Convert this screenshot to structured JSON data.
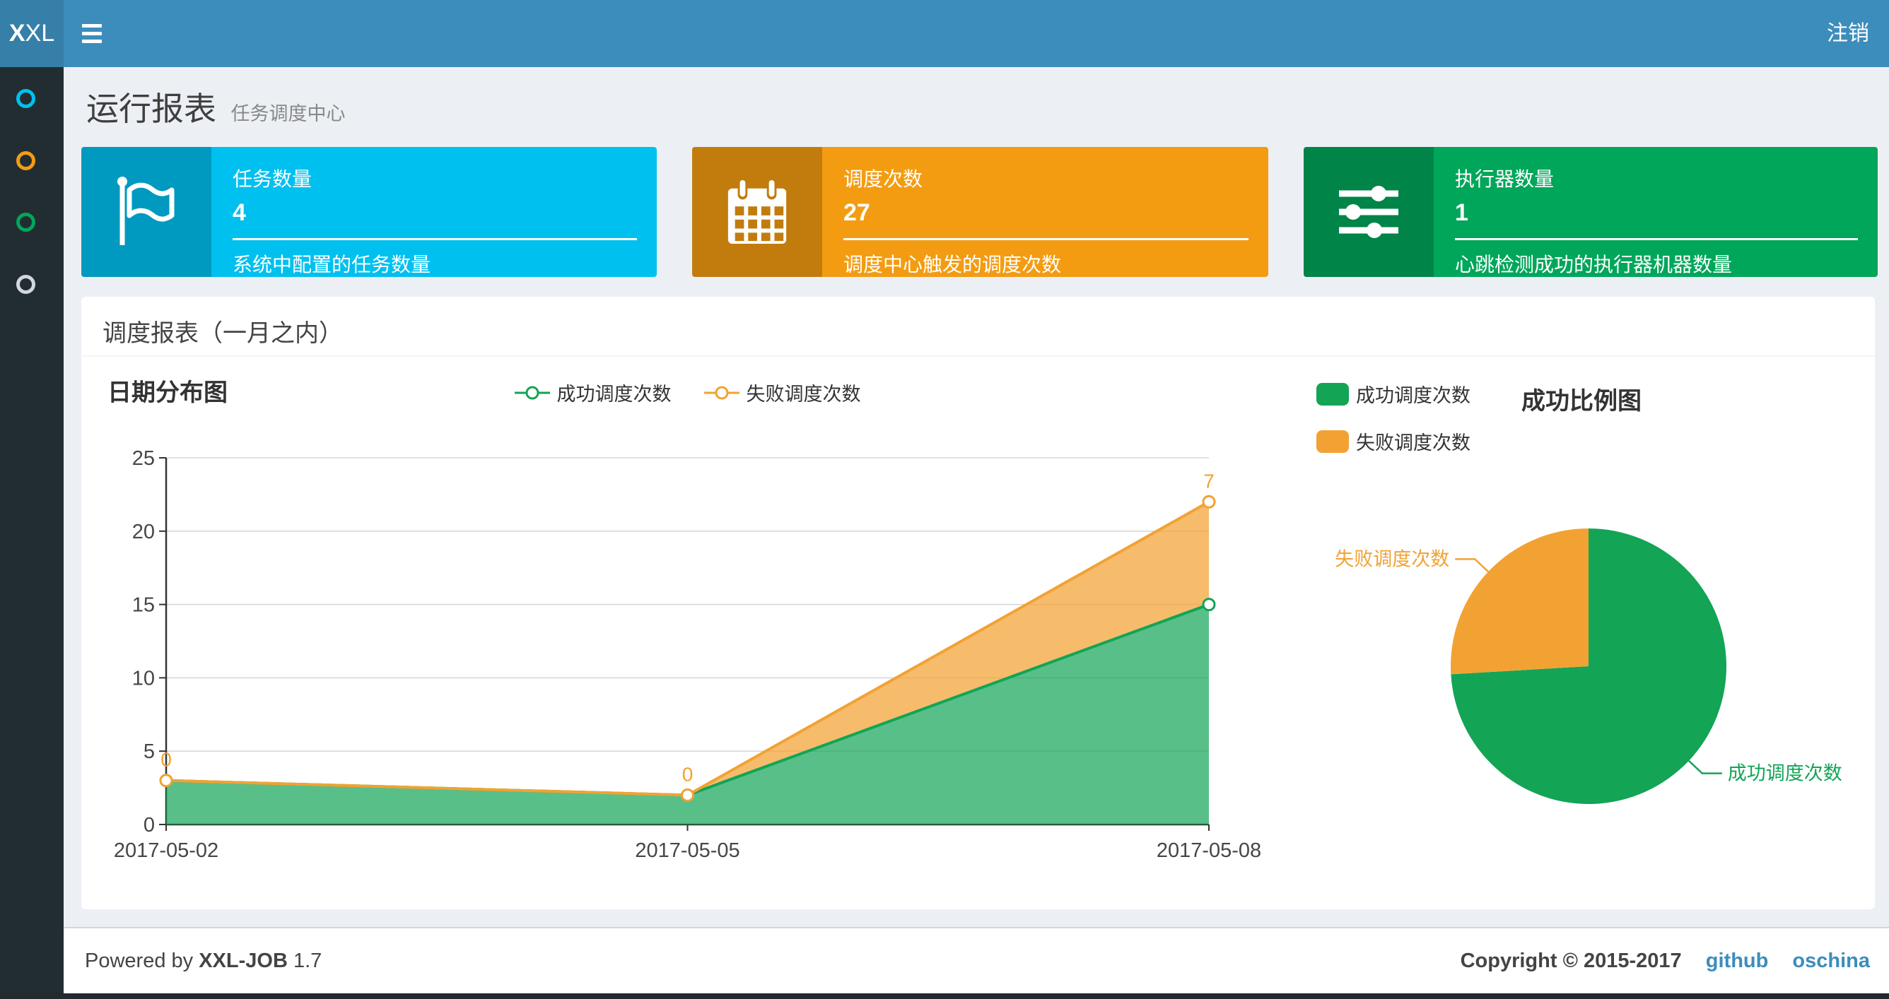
{
  "navbar": {
    "logo_bold": "X",
    "logo_rest": "XL",
    "logout_label": "注销"
  },
  "sidebar": {
    "items": [
      {
        "name": "menu-run-report",
        "color": "#00c0ef"
      },
      {
        "name": "menu-job-manage",
        "color": "#f39c12"
      },
      {
        "name": "menu-job-log",
        "color": "#00a65a"
      },
      {
        "name": "menu-executor-manage",
        "color": "#d2d6de"
      }
    ]
  },
  "page_header": {
    "title": "运行报表",
    "subtitle": "任务调度中心"
  },
  "stat_cards": [
    {
      "label": "任务数量",
      "value": "4",
      "desc": "系统中配置的任务数量",
      "color": "#00c0ef",
      "icon": "flag-icon"
    },
    {
      "label": "调度次数",
      "value": "27",
      "desc": "调度中心触发的调度次数",
      "color": "#f39c12",
      "icon": "calendar-icon"
    },
    {
      "label": "执行器数量",
      "value": "1",
      "desc": "心跳检测成功的执行器机器数量",
      "color": "#00a65a",
      "icon": "sliders-icon"
    }
  ],
  "panel": {
    "title": "调度报表（一月之内）"
  },
  "chart_data": [
    {
      "type": "area",
      "title": "日期分布图",
      "stacked": true,
      "x": [
        "2017-05-02",
        "2017-05-05",
        "2017-05-08"
      ],
      "series": [
        {
          "name": "成功调度次数",
          "values": [
            3,
            2,
            15
          ],
          "color": "#13A456",
          "area_fill": "rgba(19,164,86,0.70)"
        },
        {
          "name": "失败调度次数",
          "values": [
            0,
            0,
            7
          ],
          "color": "#F2A233",
          "area_fill": "rgba(242,162,51,0.72)"
        }
      ],
      "point_labels_series": "失败调度次数",
      "point_labels": [
        "0",
        "0",
        "7"
      ],
      "y_ticks": [
        0,
        5,
        10,
        15,
        20,
        25
      ],
      "ylim": [
        0,
        25
      ],
      "grid": true,
      "legend_position": "top-center"
    },
    {
      "type": "pie",
      "title": "成功比例图",
      "start_angle": "top",
      "clockwise": true,
      "slices": [
        {
          "name": "成功调度次数",
          "value": 20,
          "color": "#13A456"
        },
        {
          "name": "失败调度次数",
          "value": 7,
          "color": "#F2A233"
        }
      ],
      "legend": [
        "成功调度次数",
        "失败调度次数"
      ],
      "legend_position": "top-left"
    }
  ],
  "footer": {
    "powered_prefix": "Powered by ",
    "product": "XXL-JOB",
    "version": " 1.7",
    "copyright": "Copyright © 2015-2017",
    "links": [
      "github",
      "oschina"
    ]
  }
}
